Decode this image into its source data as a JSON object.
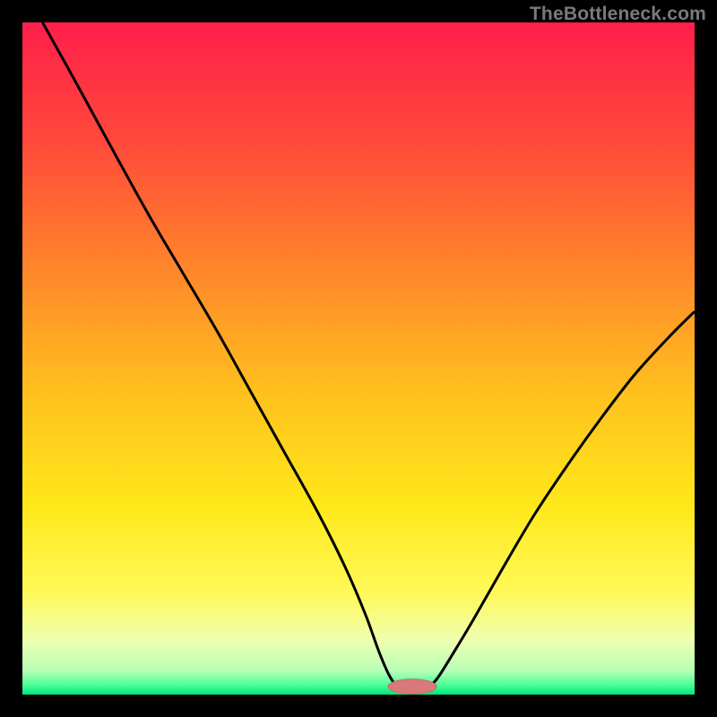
{
  "watermark": "TheBottleneck.com",
  "colors": {
    "frame": "#000000",
    "curve": "#000000",
    "marker_fill": "#d87a7a",
    "marker_stroke": "#c96a6a",
    "gradient_stops": [
      {
        "offset": 0.0,
        "color": "#ff1e4b"
      },
      {
        "offset": 0.18,
        "color": "#ff4a3a"
      },
      {
        "offset": 0.38,
        "color": "#ff8a2a"
      },
      {
        "offset": 0.55,
        "color": "#ffc01e"
      },
      {
        "offset": 0.72,
        "color": "#ffe81a"
      },
      {
        "offset": 0.85,
        "color": "#fff95a"
      },
      {
        "offset": 0.92,
        "color": "#eeffb0"
      },
      {
        "offset": 0.965,
        "color": "#b6ffb6"
      },
      {
        "offset": 0.985,
        "color": "#4dff9a"
      },
      {
        "offset": 1.0,
        "color": "#00e57a"
      }
    ]
  },
  "chart_data": {
    "type": "line",
    "title": "",
    "xlabel": "",
    "ylabel": "",
    "xlim": [
      0,
      100
    ],
    "ylim": [
      0,
      100
    ],
    "marker": {
      "x": 58,
      "y": 1.2,
      "rx": 3.6,
      "ry": 1.1
    },
    "series": [
      {
        "name": "bottleneck-curve",
        "points": [
          {
            "x": 3.0,
            "y": 100.0
          },
          {
            "x": 8.0,
            "y": 91.0
          },
          {
            "x": 14.0,
            "y": 80.0
          },
          {
            "x": 19.0,
            "y": 71.0
          },
          {
            "x": 24.0,
            "y": 62.5
          },
          {
            "x": 29.0,
            "y": 54.0
          },
          {
            "x": 34.0,
            "y": 45.0
          },
          {
            "x": 39.0,
            "y": 36.0
          },
          {
            "x": 44.0,
            "y": 27.0
          },
          {
            "x": 48.0,
            "y": 19.0
          },
          {
            "x": 51.0,
            "y": 12.0
          },
          {
            "x": 53.0,
            "y": 6.5
          },
          {
            "x": 54.5,
            "y": 3.0
          },
          {
            "x": 55.7,
            "y": 1.3
          },
          {
            "x": 57.0,
            "y": 0.9
          },
          {
            "x": 58.5,
            "y": 0.9
          },
          {
            "x": 60.0,
            "y": 1.0
          },
          {
            "x": 61.0,
            "y": 1.6
          },
          {
            "x": 62.0,
            "y": 2.8
          },
          {
            "x": 64.0,
            "y": 6.0
          },
          {
            "x": 67.0,
            "y": 11.0
          },
          {
            "x": 71.0,
            "y": 18.0
          },
          {
            "x": 76.0,
            "y": 26.5
          },
          {
            "x": 81.0,
            "y": 34.0
          },
          {
            "x": 86.0,
            "y": 41.0
          },
          {
            "x": 91.0,
            "y": 47.5
          },
          {
            "x": 96.0,
            "y": 53.0
          },
          {
            "x": 100.0,
            "y": 57.0
          }
        ]
      }
    ]
  }
}
